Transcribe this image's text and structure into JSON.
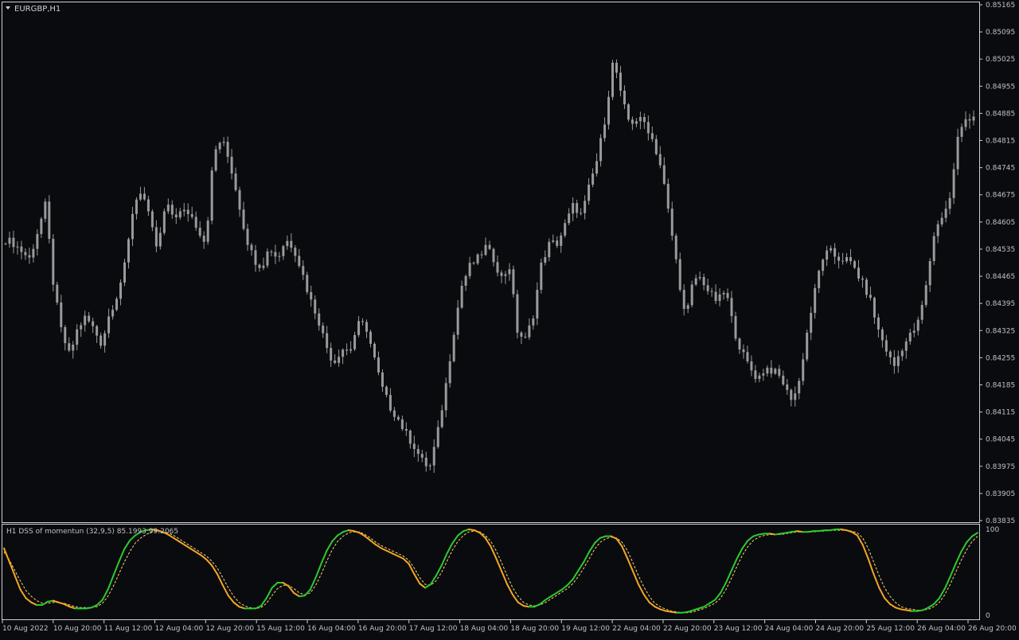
{
  "window": {
    "symbol_label": "EURGBP,H1"
  },
  "colors": {
    "background": "#0a0b0f",
    "frame": "#d0d0d0",
    "candle": "#9a9a9a",
    "axis_text": "#c0c0c0",
    "dss_line": "#2ec92e",
    "dss_down": "#f5a623",
    "signal_line": "#f5d76e"
  },
  "chart_data": [
    {
      "type": "candlestick",
      "title": "EURGBP,H1",
      "ylim": [
        0.83835,
        0.85165
      ],
      "y_tick_labels": [
        "0.85165",
        "0.85095",
        "0.85025",
        "0.84955",
        "0.84885",
        "0.84815",
        "0.84745",
        "0.84675",
        "0.84605",
        "0.84535",
        "0.84465",
        "0.84395",
        "0.84325",
        "0.84255",
        "0.84185",
        "0.84115",
        "0.84045",
        "0.83975",
        "0.83905",
        "0.83835"
      ],
      "x_tick_labels": [
        "10 Aug 2022",
        "10 Aug 20:00",
        "11 Aug 12:00",
        "12 Aug 04:00",
        "12 Aug 20:00",
        "15 Aug 12:00",
        "16 Aug 04:00",
        "16 Aug 20:00",
        "17 Aug 12:00",
        "18 Aug 04:00",
        "18 Aug 20:00",
        "19 Aug 12:00",
        "22 Aug 04:00",
        "22 Aug 20:00",
        "23 Aug 12:00",
        "24 Aug 04:00",
        "24 Aug 20:00",
        "25 Aug 12:00",
        "26 Aug 04:00",
        "26 Aug 20:00"
      ],
      "close_path": [
        0.8456,
        0.8455,
        0.8453,
        0.8451,
        0.8458,
        0.8465,
        0.8444,
        0.8432,
        0.8426,
        0.8433,
        0.8436,
        0.8433,
        0.8429,
        0.8437,
        0.8442,
        0.845,
        0.8465,
        0.8469,
        0.8461,
        0.8453,
        0.8465,
        0.8462,
        0.8463,
        0.8463,
        0.8459,
        0.8455,
        0.8478,
        0.8482,
        0.8476,
        0.8467,
        0.8457,
        0.8451,
        0.8449,
        0.8454,
        0.8451,
        0.8456,
        0.8454,
        0.8448,
        0.8441,
        0.8436,
        0.8429,
        0.8424,
        0.8428,
        0.8427,
        0.8434,
        0.8434,
        0.8426,
        0.8418,
        0.8413,
        0.841,
        0.8406,
        0.8403,
        0.8399,
        0.8397,
        0.8406,
        0.8418,
        0.8432,
        0.8444,
        0.8449,
        0.8451,
        0.8454,
        0.8451,
        0.8446,
        0.8449,
        0.8432,
        0.843,
        0.8437,
        0.845,
        0.8455,
        0.8455,
        0.846,
        0.8465,
        0.8462,
        0.847,
        0.8477,
        0.8488,
        0.8503,
        0.8492,
        0.8486,
        0.8487,
        0.8486,
        0.8481,
        0.8474,
        0.8461,
        0.8448,
        0.8435,
        0.8446,
        0.8446,
        0.8442,
        0.844,
        0.8443,
        0.8433,
        0.8427,
        0.8423,
        0.842,
        0.8423,
        0.8422,
        0.842,
        0.8415,
        0.8417,
        0.843,
        0.8441,
        0.8451,
        0.8453,
        0.8451,
        0.8451,
        0.8449,
        0.8445,
        0.8441,
        0.8433,
        0.8428,
        0.8423,
        0.8428,
        0.8431,
        0.8434,
        0.8443,
        0.8457,
        0.8462,
        0.8466,
        0.8482,
        0.8487,
        0.8488
      ],
      "marks_count": 120
    },
    {
      "type": "line",
      "title": "H1 DSS of momentun (32,9,5) 85.1993 99.2065",
      "ylim": [
        0,
        100
      ],
      "y_tick_labels": [
        "100",
        "0"
      ],
      "series": [
        {
          "values": [
            78,
            62,
            46,
            30,
            20,
            15,
            12,
            12,
            16,
            17,
            15,
            13,
            10,
            8,
            8,
            8,
            9,
            12,
            18,
            30,
            46,
            62,
            77,
            87,
            93,
            97,
            99,
            100,
            99,
            97,
            94,
            90,
            86,
            82,
            78,
            74,
            70,
            65,
            58,
            48,
            35,
            23,
            15,
            10,
            8,
            8,
            8,
            11,
            20,
            32,
            38,
            38,
            34,
            26,
            22,
            23,
            30,
            44,
            60,
            75,
            86,
            93,
            97,
            99,
            98,
            96,
            92,
            87,
            82,
            78,
            75,
            72,
            69,
            66,
            60,
            48,
            37,
            32,
            36,
            46,
            58,
            72,
            84,
            93,
            98,
            100,
            99,
            96,
            90,
            80,
            66,
            51,
            36,
            24,
            15,
            11,
            10,
            10,
            13,
            18,
            22,
            26,
            30,
            35,
            42,
            52,
            62,
            74,
            84,
            90,
            92,
            92,
            89,
            80,
            66,
            51,
            36,
            24,
            15,
            10,
            7,
            5,
            4,
            3,
            3,
            4,
            6,
            8,
            10,
            14,
            18,
            26,
            38,
            52,
            66,
            78,
            87,
            92,
            94,
            95,
            95,
            94,
            95,
            96,
            97,
            98,
            97,
            97,
            98,
            98,
            99,
            99,
            100,
            100,
            99,
            97,
            93,
            82,
            66,
            48,
            32,
            20,
            13,
            9,
            7,
            6,
            5,
            5,
            6,
            9,
            13,
            20,
            31,
            45,
            60,
            74,
            85,
            92,
            96
          ]
        },
        {
          "values": [
            74,
            64,
            52,
            40,
            29,
            22,
            17,
            14,
            14,
            15,
            15,
            14,
            12,
            10,
            9,
            9,
            9,
            10,
            14,
            22,
            34,
            48,
            62,
            74,
            84,
            90,
            94,
            97,
            98,
            97,
            96,
            93,
            89,
            85,
            81,
            77,
            73,
            69,
            63,
            55,
            44,
            32,
            22,
            15,
            11,
            9,
            8,
            9,
            14,
            23,
            31,
            35,
            35,
            31,
            26,
            24,
            26,
            35,
            48,
            63,
            76,
            86,
            92,
            96,
            97,
            97,
            94,
            90,
            85,
            81,
            78,
            75,
            72,
            69,
            64,
            55,
            44,
            36,
            35,
            40,
            50,
            63,
            76,
            86,
            93,
            97,
            98,
            97,
            93,
            86,
            75,
            61,
            46,
            32,
            22,
            15,
            12,
            11,
            12,
            15,
            19,
            23,
            27,
            31,
            37,
            45,
            55,
            66,
            77,
            85,
            89,
            91,
            90,
            85,
            75,
            61,
            46,
            33,
            22,
            14,
            10,
            7,
            5,
            4,
            3,
            3,
            4,
            6,
            8,
            11,
            14,
            20,
            30,
            43,
            57,
            70,
            80,
            87,
            91,
            93,
            94,
            94,
            94,
            95,
            96,
            97,
            97,
            97,
            97,
            98,
            98,
            99,
            99,
            99,
            99,
            98,
            96,
            90,
            78,
            62,
            46,
            32,
            22,
            15,
            10,
            8,
            7,
            6,
            6,
            7,
            10,
            15,
            24,
            36,
            50,
            64,
            76,
            86,
            92
          ]
        }
      ]
    }
  ]
}
